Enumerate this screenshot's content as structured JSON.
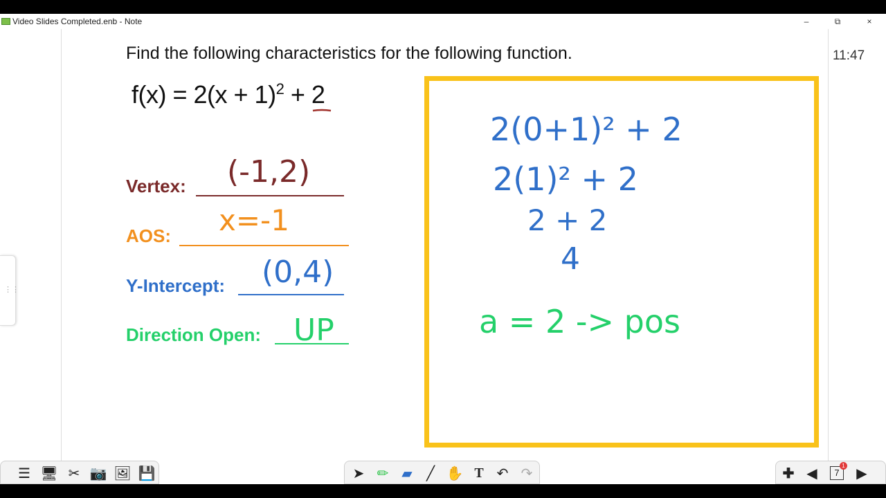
{
  "window": {
    "title": "Video Slides Completed.enb - Note",
    "minimize_label": "–",
    "restore_label": "⧉",
    "close_label": "×"
  },
  "clock": "11:47",
  "slide": {
    "heading": "Find the following characteristics for the following function.",
    "function": {
      "prefix": "f(x) = 2(x + 1)",
      "exponent": "2",
      "middle": " + ",
      "constant": "2"
    },
    "labels": {
      "vertex": "Vertex:",
      "aos": "AOS:",
      "y_intercept": "Y-Intercept:",
      "direction": "Direction Open:"
    },
    "answers": {
      "vertex": "(-1,2)",
      "aos": "x=-1",
      "y_intercept": "(0,4)",
      "direction": "UP"
    },
    "work_lines": [
      "2(0+1)² + 2",
      "2(1)² + 2",
      "2 + 2",
      "4"
    ],
    "a_note": "a = 2 -> pos"
  },
  "colors": {
    "vertex": "#7a2a2a",
    "aos": "#f2901e",
    "y_intercept": "#2f6fc9",
    "direction": "#24d06a",
    "box_border": "#f9c21a",
    "work_ink": "#2f6fc9"
  },
  "toolbar": {
    "left_icons": [
      "menu-icon",
      "display-icon",
      "tools-icon",
      "document-camera-icon",
      "image-icon",
      "save-icon"
    ],
    "center_icons": [
      "select-arrow-icon",
      "pen-icon",
      "eraser-icon",
      "line-icon",
      "hand-icon",
      "text-icon",
      "undo-icon",
      "redo-icon"
    ],
    "page_number": "7",
    "page_badge": "1"
  }
}
